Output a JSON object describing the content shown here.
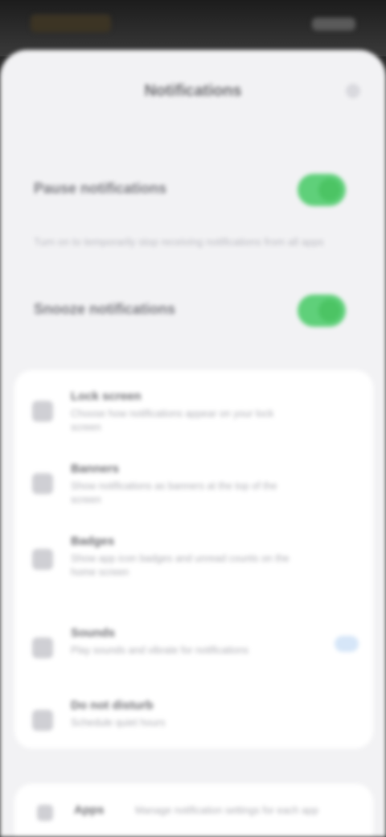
{
  "status": {
    "left_icon": "status-left-icon",
    "right_icon": "status-right-icon"
  },
  "header": {
    "title": "Notifications"
  },
  "toggles": [
    {
      "label": "Pause notifications"
    },
    {
      "label": "Snooze notifications"
    }
  ],
  "hint": {
    "text": "Turn on to temporarily stop receiving notifications from all apps"
  },
  "settings": [
    {
      "name": "Lock screen",
      "desc": "Choose how notifications appear on your lock screen"
    },
    {
      "name": "Banners",
      "desc": "Show notifications as banners at the top of the screen"
    },
    {
      "name": "Badges",
      "desc": "Show app icon badges and unread counts on the home screen"
    },
    {
      "name": "Sounds",
      "desc": "Play sounds and vibrate for notifications"
    },
    {
      "name": "Do not disturb",
      "desc": "Schedule quiet hours"
    }
  ],
  "bottom": {
    "name": "Apps",
    "desc": "Manage notification settings for each app"
  },
  "colors": {
    "toggle_on": "#4cc464",
    "sheet": "#f2f2f4"
  }
}
